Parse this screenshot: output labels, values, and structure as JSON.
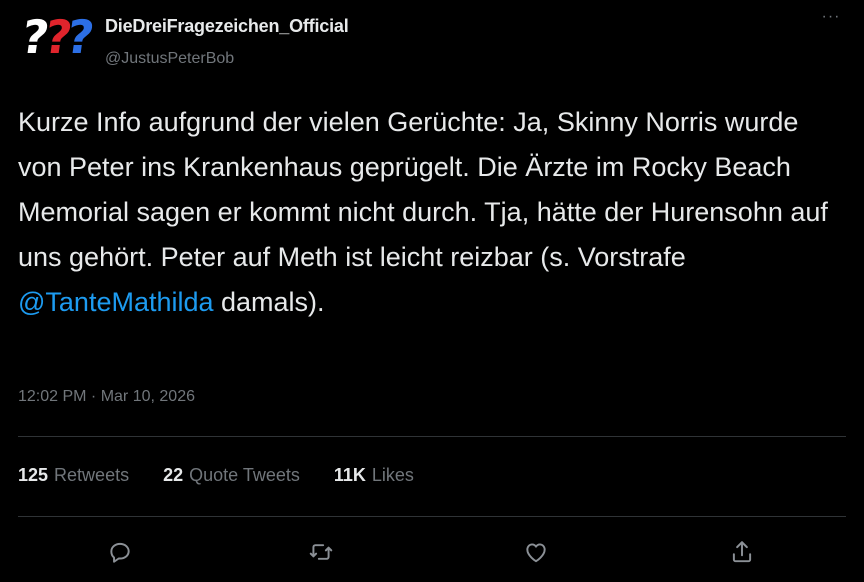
{
  "account": {
    "display_name": "DieDreiFragezeichen_Official",
    "handle": "@JustusPeterBob",
    "avatar_marks": [
      "?",
      "?",
      "?"
    ]
  },
  "tweet": {
    "text_before_mention": "Kurze Info aufgrund der vielen Gerüchte: Ja, Skinny Norris wurde von Peter ins Krankenhaus geprügelt. Die Ärzte im Rocky Beach Memorial sagen er kommt nicht durch. Tja, hätte der Hurensohn auf uns gehört. Peter auf Meth ist leicht reizbar (s. Vorstrafe ",
    "mention": "@TanteMathilda",
    "text_after_mention": " damals).",
    "timestamp": "12:02 PM · Mar 10, 2026"
  },
  "stats": {
    "retweets_count": "125",
    "retweets_label": "Retweets",
    "quotes_count": "22",
    "quotes_label": "Quote Tweets",
    "likes_count": "11K",
    "likes_label": "Likes"
  },
  "menu": {
    "more_label": "···"
  },
  "icons": {
    "reply": "reply-icon",
    "retweet": "retweet-icon",
    "like": "heart-icon",
    "share": "share-icon"
  },
  "colors": {
    "background": "#000000",
    "text": "#e7e9ea",
    "muted": "#71767b",
    "link": "#1d9bf0",
    "avatar_red": "#e0242c",
    "avatar_blue": "#2c6fe6"
  }
}
